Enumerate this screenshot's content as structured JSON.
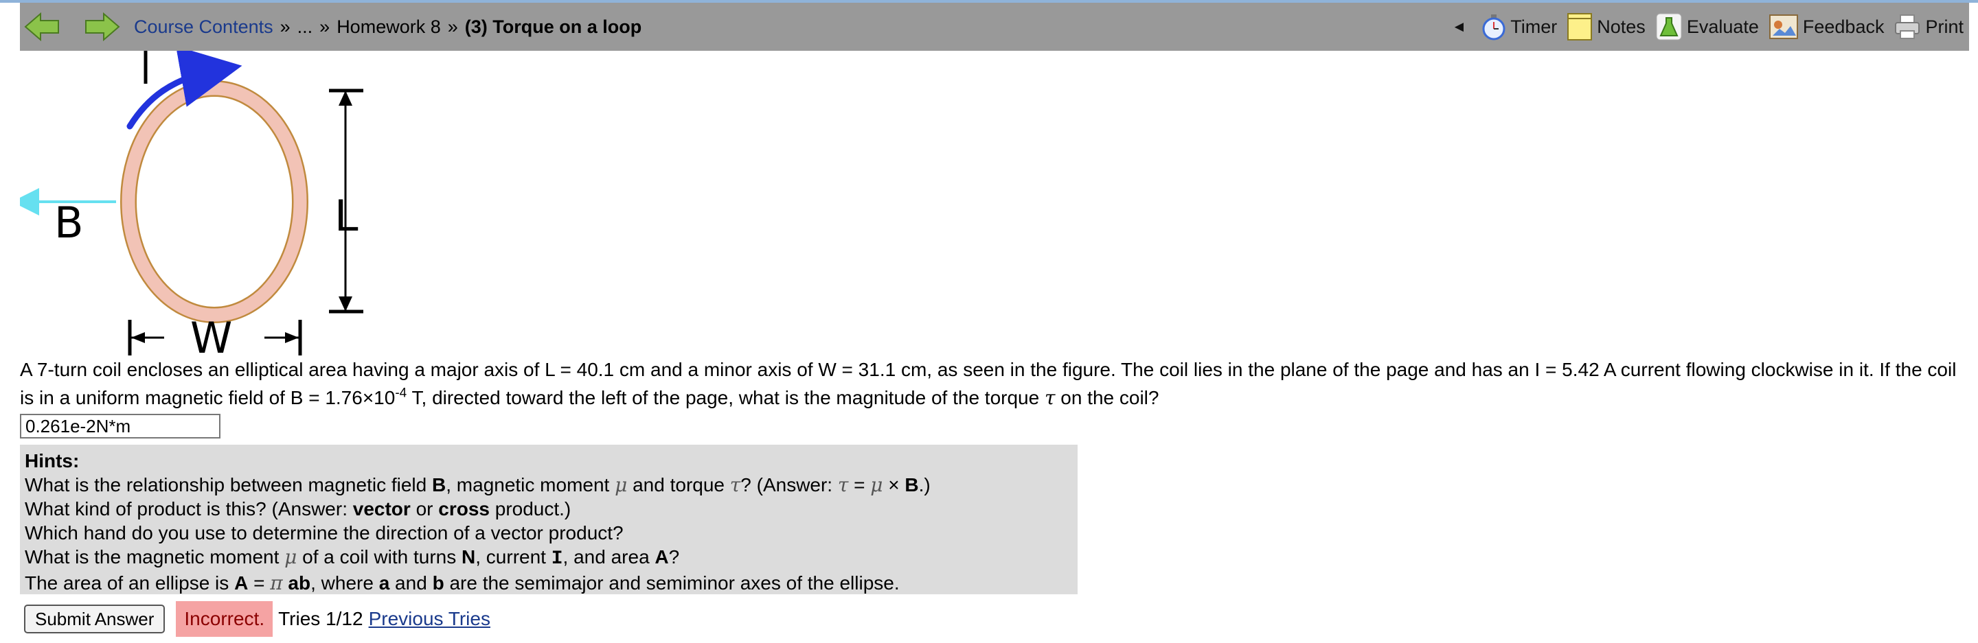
{
  "nav": {
    "crumbs": [
      "Course Contents",
      "...",
      "Homework 8"
    ],
    "separator": "»",
    "current": "(3) Torque on a loop",
    "prev_symbol": "◄",
    "tools": [
      "Timer",
      "Notes",
      "Evaluate",
      "Feedback",
      "Print"
    ]
  },
  "figure": {
    "label_i": "I",
    "label_b": "B",
    "label_l": "L",
    "label_w": "W"
  },
  "problem": {
    "part1": "A 7-turn coil encloses an elliptical area having a major axis of L = 40.1 cm and a minor axis of W = 31.1 cm, as seen in the figure. The coil lies in the plane of the page and has an I = 5.42 A current flowing clockwise in it. If the coil is in a uniform magnetic field of B = 1.76×10",
    "exponent": "-4",
    "part2": " T, directed toward the left of the page, what is the magnitude of the torque ",
    "tau": "τ",
    "part3": " on the coil?"
  },
  "answer": {
    "value": "0.261e-2N*m"
  },
  "hints": {
    "title": "Hints:",
    "h1a": "What is the relationship between magnetic field ",
    "h1b": "B",
    "h1c": ", magnetic moment ",
    "mu": "μ",
    "h1d": " and torque ",
    "tau": "τ",
    "h1e": "? (Answer: ",
    "eq": " = ",
    "cross": " × ",
    "h1f": "B",
    "h1g": ".)",
    "h2a": "What kind of product is this? (Answer: ",
    "h2b": "vector",
    "h2c": " or ",
    "h2d": "cross",
    "h2e": " product.)",
    "h3": "Which hand do you use to determine the direction of a vector product?",
    "h4a": "What is the magnetic moment ",
    "h4b": " of a coil with turns ",
    "h4c": "N",
    "h4d": ", current ",
    "h4e": "I",
    "h4f": ", and area ",
    "h4g": "A",
    "h4h": "?",
    "h5a": "The area of an ellipse is ",
    "h5b": "A",
    "h5c": " = ",
    "pi": "π",
    "h5d": " ab",
    "h5e": ", where ",
    "h5f": "a",
    "h5g": " and ",
    "h5h": "b",
    "h5i": " are the semimajor and semiminor axes of the ellipse."
  },
  "bottom": {
    "submit": "Submit Answer",
    "status": "Incorrect.",
    "tries": "Tries 1/12",
    "previous": "Previous Tries"
  },
  "colors": {
    "navbar": "#999999",
    "coil_fill": "#f2c3b6",
    "coil_border": "#c08a3e",
    "current_arrow": "#2233dd",
    "field_arrow": "#66e0f0",
    "hint_bg": "#dcdcdc",
    "incorrect_bg": "#f5a3a3"
  }
}
